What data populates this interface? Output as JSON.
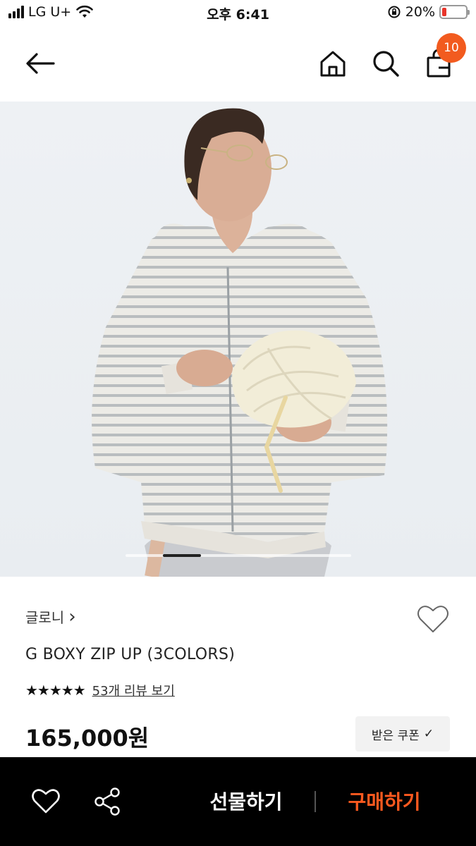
{
  "status_bar": {
    "carrier": "LG U+",
    "time": "오후 6:41",
    "battery": "20%",
    "battery_level": 0.2
  },
  "nav": {
    "cart_count": "10"
  },
  "product": {
    "brand": "글로니",
    "brand_chevron": "›",
    "name": "G BOXY ZIP UP (3COLORS)",
    "rating_stars": "★★★★★",
    "review_link": "53개 리뷰 보기",
    "price": "165,000원",
    "coupon_label": "받은 쿠폰",
    "coupon_check": "✓"
  },
  "image_carousel": {
    "active_index": 1,
    "count": 6
  },
  "bottom_bar": {
    "gift_label": "선물하기",
    "buy_label": "구매하기"
  },
  "colors": {
    "accent": "#ff5a1f",
    "badge": "#f25b1f",
    "battery_low": "#e8352b"
  }
}
